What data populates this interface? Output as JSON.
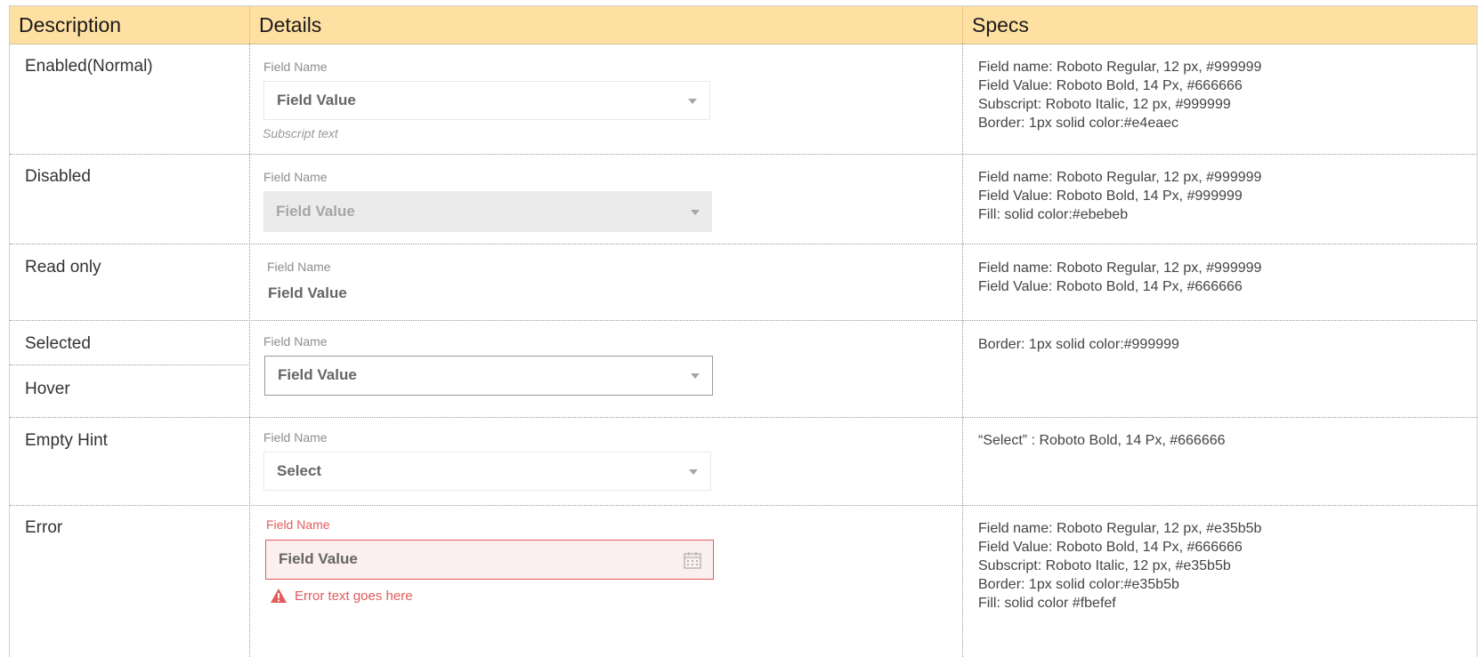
{
  "header": {
    "description": "Description",
    "details": "Details",
    "specs": "Specs"
  },
  "colors": {
    "header_bg": "#ffe0a3",
    "border": "#e4eaec",
    "disabled_fill": "#ebebeb",
    "selected_border": "#999999",
    "error": "#e35b5b",
    "error_fill": "#fbefef"
  },
  "rows": {
    "enabled": {
      "description": "Enabled(Normal)",
      "field_name": "Field Name",
      "field_value": "Field Value",
      "subscript": "Subscript text",
      "specs": [
        "Field name: Roboto Regular, 12 px, #999999",
        "Field Value: Roboto Bold, 14 Px, #666666",
        "Subscript: Roboto Italic, 12 px, #999999",
        "Border: 1px solid color:#e4eaec"
      ]
    },
    "disabled": {
      "description": "Disabled",
      "field_name": "Field Name",
      "field_value": "Field Value",
      "specs": [
        "Field name: Roboto Regular, 12 px, #999999",
        "Field Value: Roboto Bold, 14 Px, #999999",
        "Fill: solid color:#ebebeb"
      ]
    },
    "readonly": {
      "description": "Read only",
      "field_name": "Field Name",
      "field_value": "Field Value",
      "specs": [
        "Field name: Roboto Regular, 12 px, #999999",
        "Field Value: Roboto Bold, 14 Px, #666666"
      ]
    },
    "selected": {
      "description": "Selected",
      "description2": "Hover",
      "field_name": "Field Name",
      "field_value": "Field Value",
      "specs": [
        "Border: 1px solid color:#999999"
      ]
    },
    "empty": {
      "description": "Empty Hint",
      "field_name": "Field Name",
      "field_value": "Select",
      "specs": [
        "“Select” : Roboto Bold, 14 Px, #666666"
      ]
    },
    "error": {
      "description": "Error",
      "field_name": "Field Name",
      "field_value": "Field Value",
      "error_text": "Error text goes here",
      "specs": [
        "Field name: Roboto Regular, 12 px, #e35b5b",
        "Field Value: Roboto Bold, 14 Px, #666666",
        "Subscript: Roboto Italic, 12 px, #e35b5b",
        "Border: 1px solid color:#e35b5b",
        "Fill: solid color #fbefef"
      ]
    }
  },
  "icons": {
    "caret": "chevron-down-icon",
    "calendar": "calendar-icon",
    "warning": "warning-icon"
  }
}
